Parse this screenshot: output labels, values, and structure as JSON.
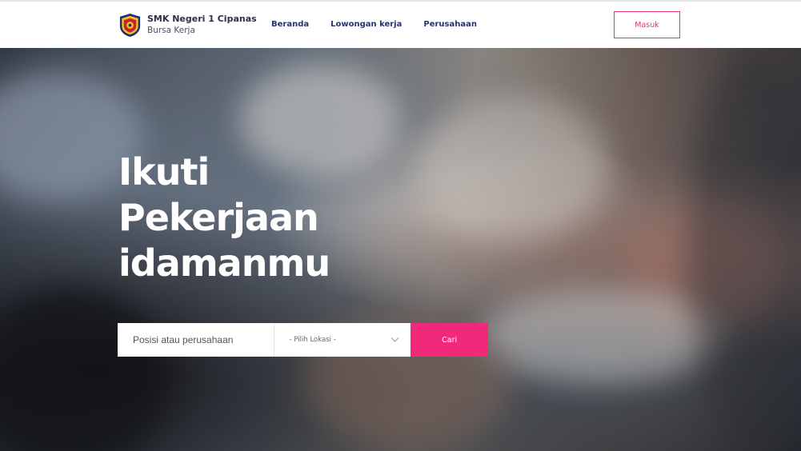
{
  "brand": {
    "name": "SMK Negeri 1 Cipanas",
    "subtitle": "Bursa Kerja",
    "logo_icon": "school-emblem-icon"
  },
  "nav": {
    "items": [
      {
        "label": "Beranda"
      },
      {
        "label": "Lowongan kerja"
      },
      {
        "label": "Perusahaan"
      }
    ],
    "login_label": "Masuk"
  },
  "hero": {
    "title_lines": [
      "Ikuti",
      "Pekerjaan",
      "idamanmu"
    ]
  },
  "search": {
    "keyword_placeholder": "Posisi atau perusahaan",
    "location_selected": "- Pilih Lokasi -",
    "submit_label": "Cari"
  },
  "colors": {
    "accent": "#f0297a",
    "nav_text": "#263468",
    "login_border": "#e8336f"
  }
}
